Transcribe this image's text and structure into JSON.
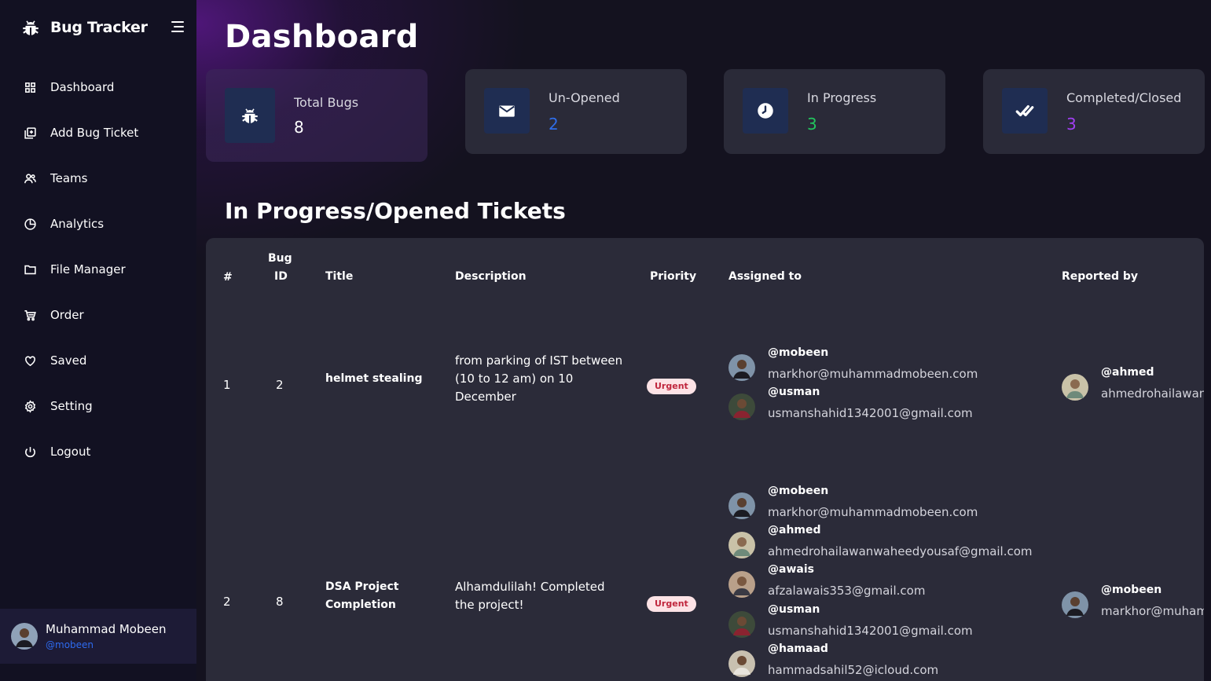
{
  "app": {
    "title": "Bug Tracker"
  },
  "sidebar": {
    "items": [
      {
        "label": "Dashboard",
        "icon": "grid-icon"
      },
      {
        "label": "Add Bug Ticket",
        "icon": "add-ticket-icon"
      },
      {
        "label": "Teams",
        "icon": "users-icon"
      },
      {
        "label": "Analytics",
        "icon": "pie-chart-icon"
      },
      {
        "label": "File Manager",
        "icon": "folder-icon"
      },
      {
        "label": "Order",
        "icon": "cart-icon"
      },
      {
        "label": "Saved",
        "icon": "heart-icon"
      },
      {
        "label": "Setting",
        "icon": "gear-icon"
      },
      {
        "label": "Logout",
        "icon": "power-icon"
      }
    ],
    "user": {
      "name": "Muhammad Mobeen",
      "handle": "@mobeen"
    }
  },
  "page": {
    "title": "Dashboard"
  },
  "stats": [
    {
      "label": "Total Bugs",
      "value": "8",
      "color": "#ffffff",
      "icon": "bug-icon"
    },
    {
      "label": "Un-Opened",
      "value": "2",
      "color": "#2f6de8",
      "icon": "envelope-icon"
    },
    {
      "label": "In Progress",
      "value": "3",
      "color": "#22c55e",
      "icon": "clock-icon"
    },
    {
      "label": "Completed/Closed",
      "value": "3",
      "color": "#a13ff2",
      "icon": "double-check-icon"
    }
  ],
  "tickets": {
    "title": "In Progress/Opened Tickets",
    "headers": {
      "num": "#",
      "bug_id_line1": "Bug",
      "bug_id_line2": "ID",
      "title": "Title",
      "description": "Description",
      "priority": "Priority",
      "assigned": "Assigned to",
      "reported": "Reported by"
    },
    "rows": [
      {
        "num": "1",
        "bug_id": "2",
        "title": "helmet stealing",
        "description_lines": [
          "from parking of IST between",
          "(10 to 12 am) on 10",
          "December"
        ],
        "priority": "Urgent",
        "assigned": [
          {
            "handle": "@mobeen",
            "email": "markhor@muhammadmobeen.com"
          },
          {
            "handle": "@usman",
            "email": "usmanshahid1342001@gmail.com"
          }
        ],
        "reported": {
          "handle": "@ahmed",
          "email": "ahmedrohailawanwaheedyousaf@gmail.com"
        }
      },
      {
        "num": "2",
        "bug_id": "8",
        "title_lines": [
          "DSA Project",
          "Completion"
        ],
        "description_lines": [
          "Alhamdulilah! Completed",
          "the project!"
        ],
        "priority": "Urgent",
        "assigned": [
          {
            "handle": "@mobeen",
            "email": "markhor@muhammadmobeen.com"
          },
          {
            "handle": "@ahmed",
            "email": "ahmedrohailawanwaheedyousaf@gmail.com"
          },
          {
            "handle": "@awais",
            "email": "afzalawais353@gmail.com"
          },
          {
            "handle": "@usman",
            "email": "usmanshahid1342001@gmail.com"
          },
          {
            "handle": "@hamaad",
            "email": "hammadsahil52@icloud.com"
          }
        ],
        "reported": {
          "handle": "@mobeen",
          "email": "markhor@muhammadmobeen.com"
        }
      }
    ]
  }
}
